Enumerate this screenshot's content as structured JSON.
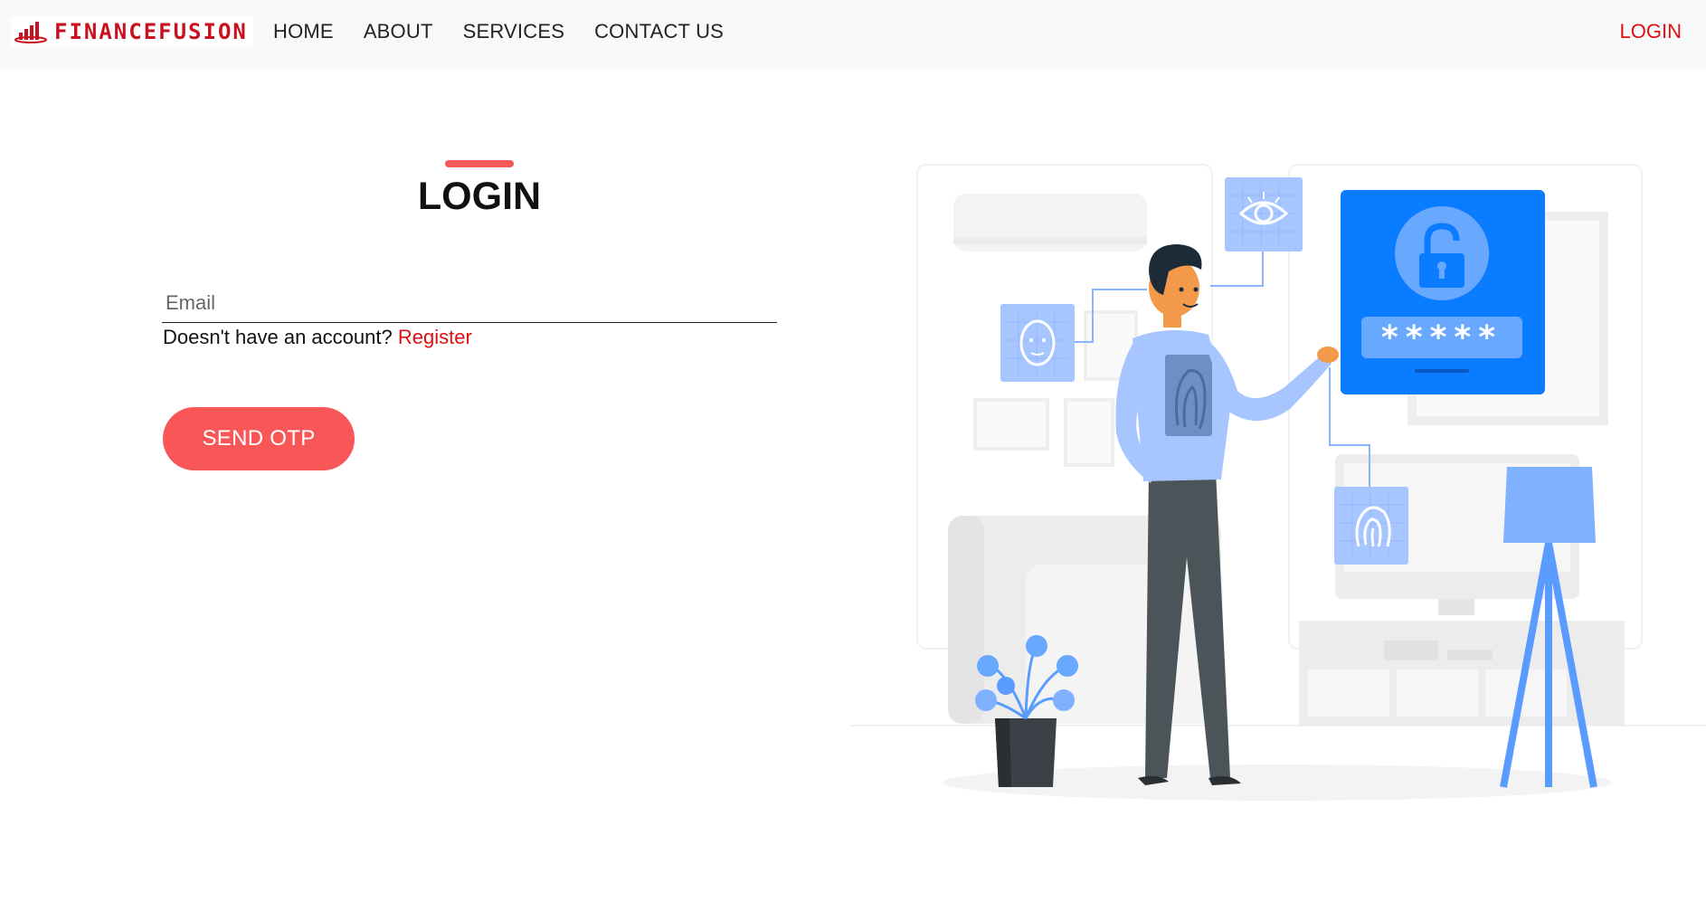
{
  "brand": {
    "name": "FINANCEFUSION",
    "accent": "#c8101e"
  },
  "nav": {
    "links": [
      {
        "label": "HOME"
      },
      {
        "label": "ABOUT"
      },
      {
        "label": "SERVICES"
      },
      {
        "label": "CONTACT US"
      }
    ],
    "login_label": "LOGIN"
  },
  "form": {
    "title": "LOGIN",
    "email_placeholder": "Email",
    "email_value": "",
    "register_prompt": "Doesn't have an account?",
    "register_link": "Register",
    "submit_label": "SEND OTP"
  },
  "illustration": {
    "password_mask": "*****",
    "icons": [
      "eye-icon",
      "face-id-icon",
      "padlock-icon",
      "fingerprint-icon"
    ]
  },
  "colors": {
    "primary_button": "#f95757",
    "link_red": "#e01010",
    "illustration_blue": "#0a7cff",
    "illustration_light_blue": "#a7c6ff"
  }
}
